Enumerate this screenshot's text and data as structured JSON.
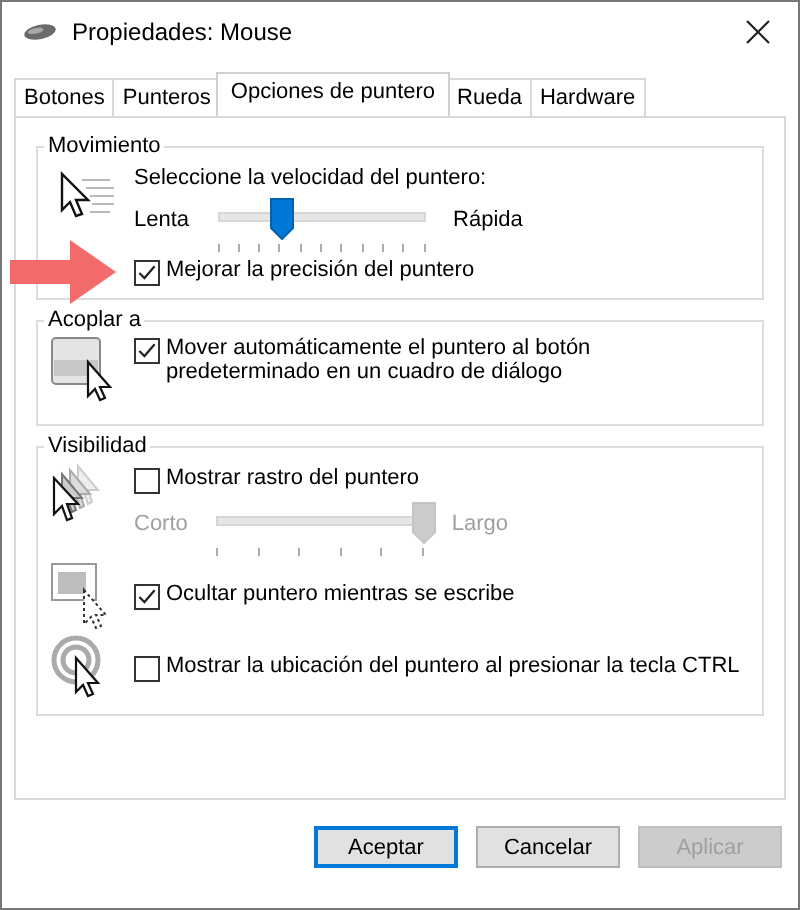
{
  "window": {
    "title": "Propiedades: Mouse"
  },
  "tabs": [
    {
      "label": "Botones",
      "selected": false
    },
    {
      "label": "Punteros",
      "selected": false
    },
    {
      "label": "Opciones de puntero",
      "selected": true
    },
    {
      "label": "Rueda",
      "selected": false
    },
    {
      "label": "Hardware",
      "selected": false
    }
  ],
  "movimiento": {
    "title": "Movimiento",
    "prompt": "Seleccione la velocidad del puntero:",
    "speed": {
      "min_label": "Lenta",
      "max_label": "Rápida",
      "level": 0.31,
      "disabled": false
    },
    "option": {
      "label": "Mejorar la precisión del puntero",
      "checked": true
    },
    "annotation_arrow": true
  },
  "acoplar": {
    "title": "Acoplar a",
    "option": {
      "label": "Mover automáticamente el puntero al botón predeterminado en un cuadro de diálogo",
      "checked": true
    }
  },
  "visibilidad": {
    "title": "Visibilidad",
    "trail": {
      "label": "Mostrar rastro del puntero",
      "checked": false
    },
    "trail_length": {
      "min_label": "Corto",
      "max_label": "Largo",
      "level": 1,
      "disabled": true
    },
    "hide": {
      "label": "Ocultar puntero mientras se escribe",
      "checked": true
    },
    "ctrl": {
      "label": "Mostrar la ubicación del puntero al presionar la tecla CTRL",
      "checked": false
    }
  },
  "buttons": [
    {
      "label": "Aceptar",
      "default": true,
      "disabled": false
    },
    {
      "label": "Cancelar",
      "default": false,
      "disabled": false
    },
    {
      "label": "Aplicar",
      "default": false,
      "disabled": true
    }
  ]
}
